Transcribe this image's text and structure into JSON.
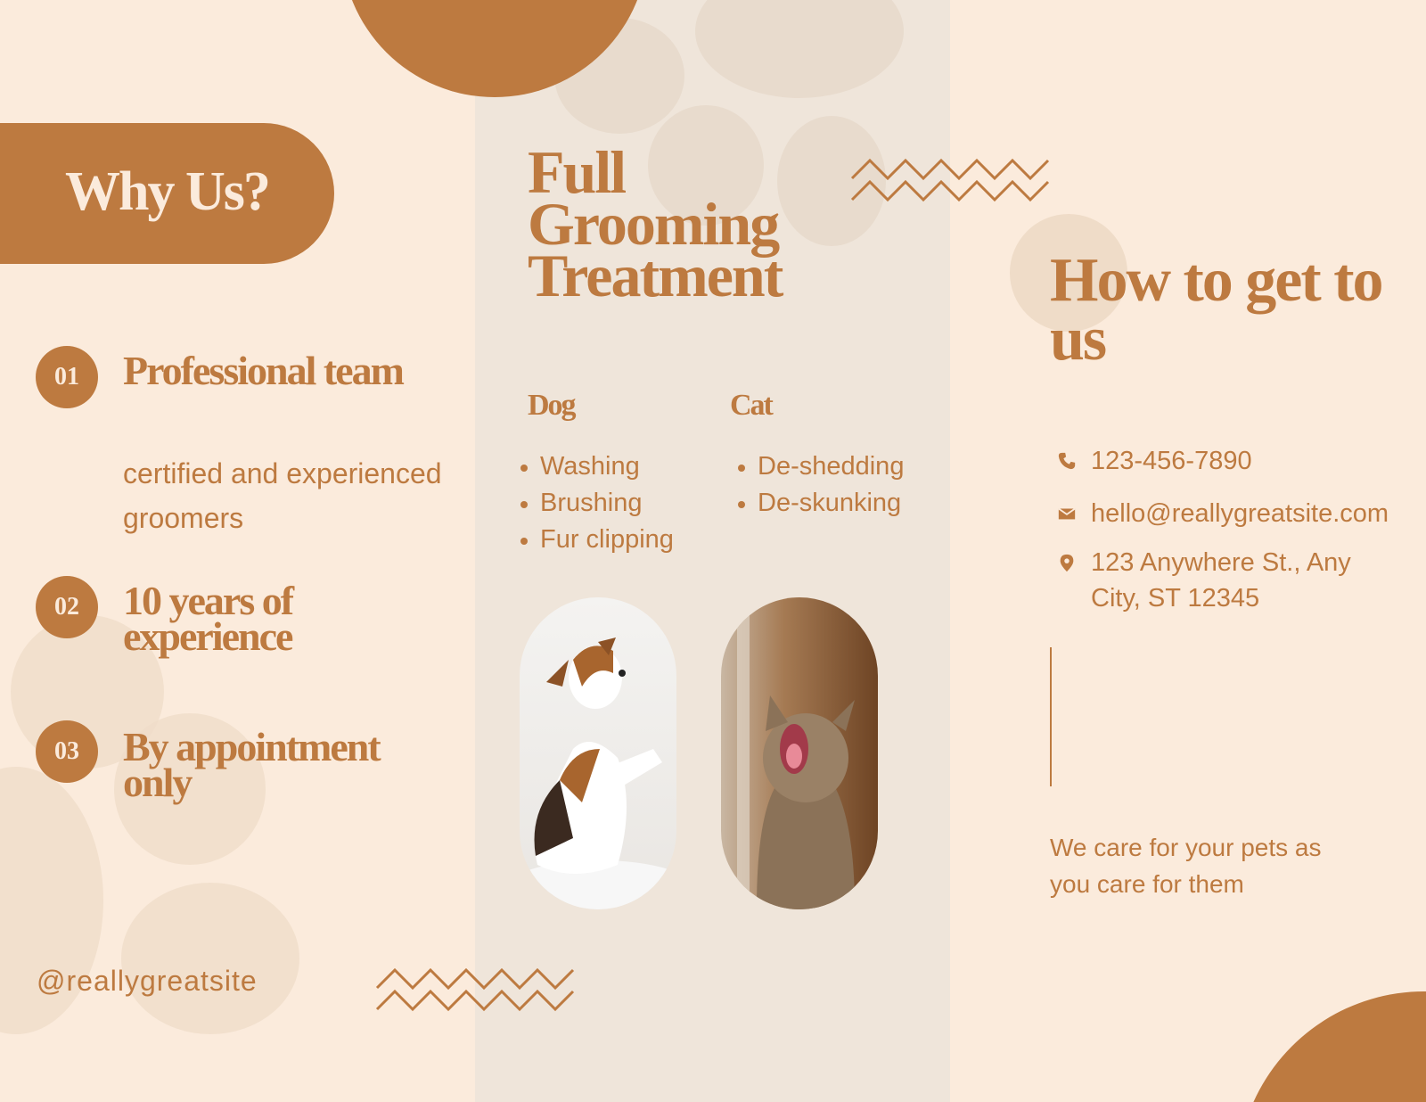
{
  "colors": {
    "brand": "#bd7a40",
    "background": "#fbebdc",
    "panel": "#efe5da",
    "accent_text": "#fbebdc"
  },
  "left": {
    "title": "Why Us?",
    "items": [
      {
        "number": "01",
        "title": "Professional team",
        "description": "certified and experienced groomers"
      },
      {
        "number": "02",
        "title": "10 years of experience"
      },
      {
        "number": "03",
        "title": "By appointment only"
      }
    ],
    "handle": "@reallygreatsite"
  },
  "middle": {
    "title": "Full Grooming Treatment",
    "dog": {
      "heading": "Dog",
      "services": [
        "Washing",
        "Brushing",
        "Fur clipping"
      ]
    },
    "cat": {
      "heading": "Cat",
      "services": [
        "De-shedding",
        "De-skunking"
      ]
    }
  },
  "right": {
    "title": "How to get to us",
    "phone": "123-456-7890",
    "email": "hello@reallygreatsite.com",
    "address": "123 Anywhere St., Any City, ST 12345",
    "tagline": "We care for your pets as you care for them"
  }
}
